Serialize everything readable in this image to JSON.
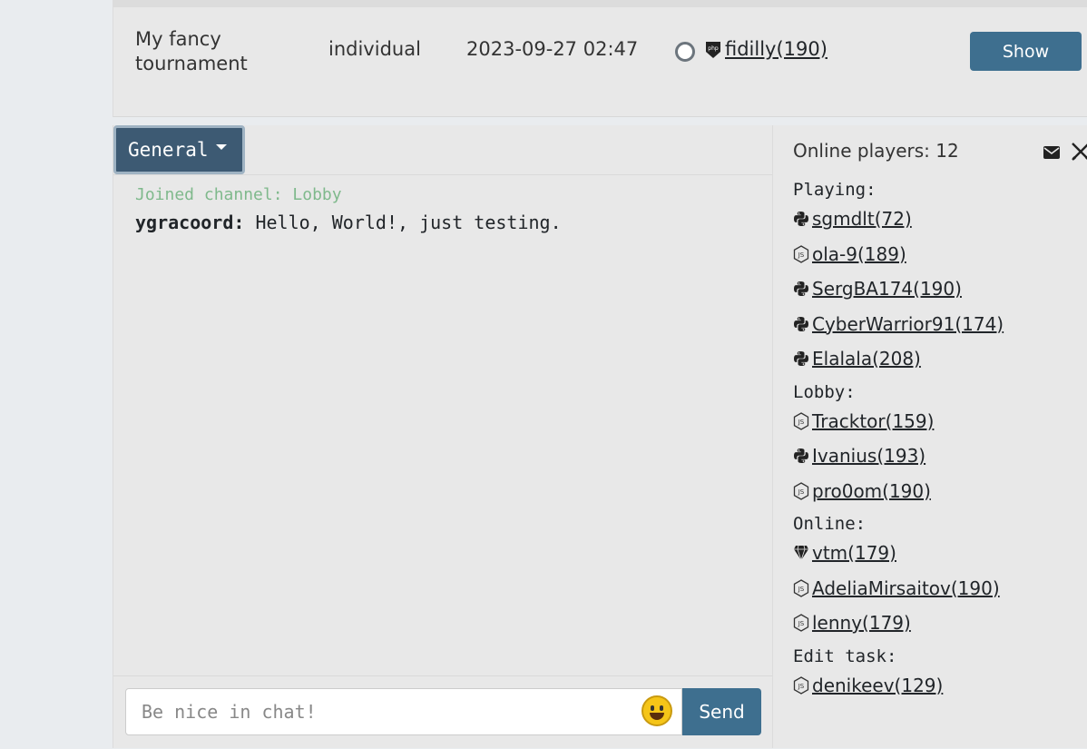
{
  "tournament": {
    "name": "My fancy tournament",
    "type": "individual",
    "date": "2023-09-27 02:47",
    "creator": "fidilly(190)",
    "creator_lang_icon": "php-icon",
    "show_label": "Show"
  },
  "chat": {
    "channel_label": "General",
    "system_message": "Joined channel: Lobby",
    "messages": [
      {
        "author": "ygracoord:",
        "text": "Hello, World!, just testing."
      }
    ],
    "input_placeholder": "Be nice in chat!",
    "send_label": "Send"
  },
  "players_panel": {
    "online_count": "Online players: 12",
    "groups": [
      {
        "label": "Playing:",
        "players": [
          {
            "name": "sgmdlt(72)",
            "lang": "python-icon"
          },
          {
            "name": "ola-9(189)",
            "lang": "js-icon"
          },
          {
            "name": "SergBA174(190)",
            "lang": "python-icon"
          },
          {
            "name": "CyberWarrior91(174)",
            "lang": "python-icon"
          },
          {
            "name": "Elalala(208)",
            "lang": "python-icon"
          }
        ]
      },
      {
        "label": "Lobby:",
        "players": [
          {
            "name": "Tracktor(159)",
            "lang": "js-icon"
          },
          {
            "name": "Ivanius(193)",
            "lang": "python-icon"
          },
          {
            "name": "pro0om(190)",
            "lang": "js-icon"
          }
        ]
      },
      {
        "label": "Online:",
        "players": [
          {
            "name": "vtm(179)",
            "lang": "ruby-icon"
          },
          {
            "name": "AdeliaMirsaitov(190)",
            "lang": "js-icon"
          },
          {
            "name": "lenny(179)",
            "lang": "js-icon"
          }
        ]
      },
      {
        "label": "Edit task:",
        "players": [
          {
            "name": "denikeev(129)",
            "lang": "js-icon"
          }
        ]
      }
    ]
  }
}
